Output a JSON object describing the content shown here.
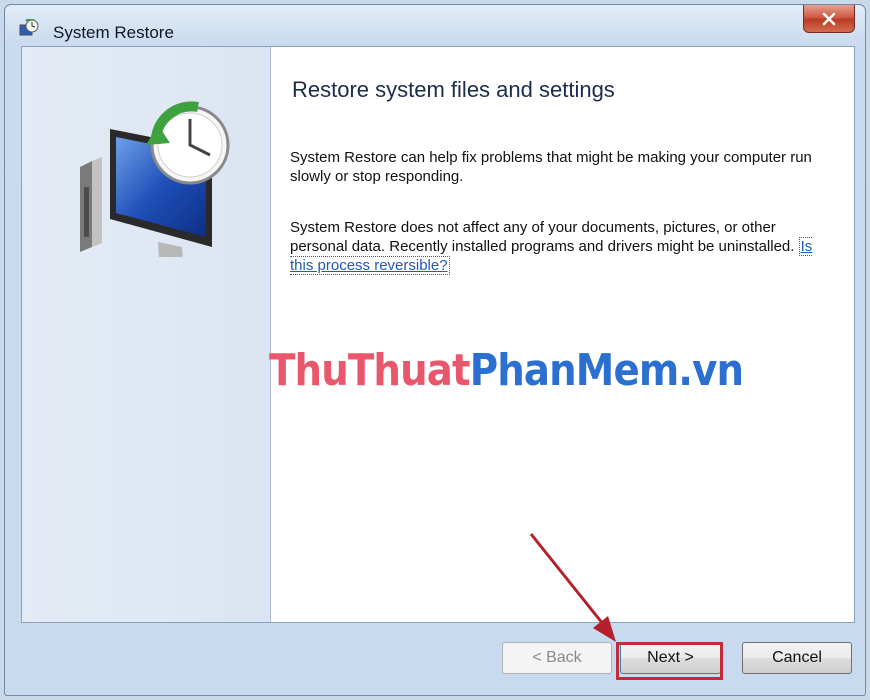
{
  "window": {
    "title": "System Restore",
    "close_glyph": "✕"
  },
  "icons": {
    "title": "system-restore-icon",
    "hero": "system-restore-monitor-clock-icon",
    "close": "close-icon"
  },
  "main": {
    "heading": "Restore system files and settings",
    "para1": "System Restore can help fix problems that might be making your computer run slowly or stop responding.",
    "para2_text": "System Restore does not affect any of your documents, pictures, or other personal data. Recently installed programs and drivers might be uninstalled. ",
    "para2_link": "Is this process reversible?"
  },
  "watermark": {
    "part1": "ThuThuat",
    "part2": "PhanMem.vn"
  },
  "footer": {
    "back_label": "< Back",
    "next_label": "Next >",
    "cancel_label": "Cancel"
  },
  "colors": {
    "accent_highlight": "#c42b36",
    "link": "#1e5bb8",
    "heading": "#1b2d4d"
  }
}
